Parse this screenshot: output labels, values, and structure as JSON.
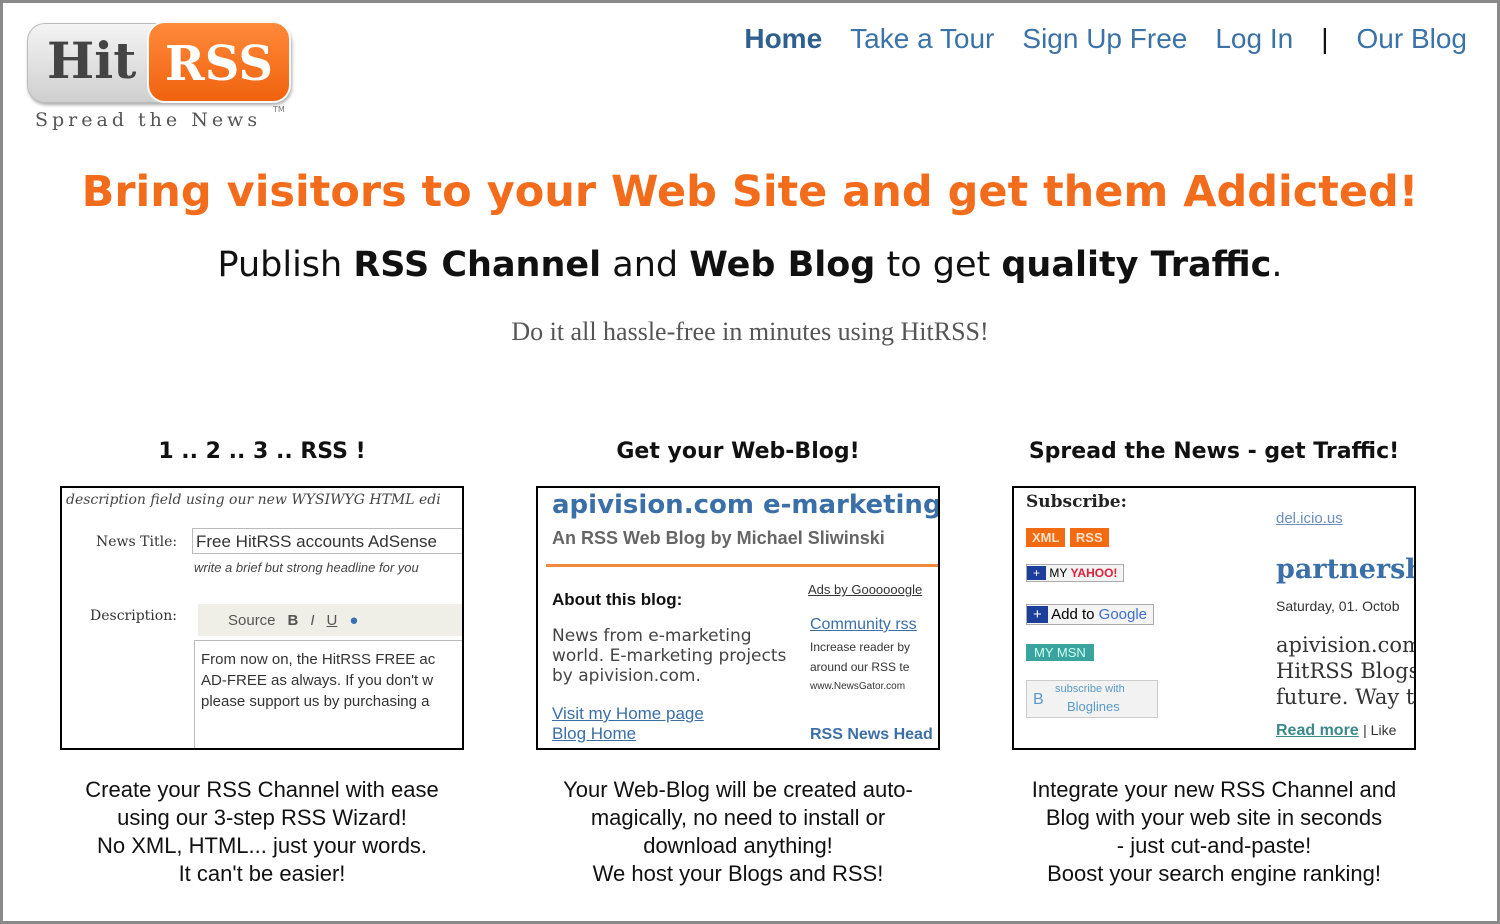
{
  "logo": {
    "hit": "Hit",
    "rss": "RSS",
    "tagline": "Spread the News",
    "tm": "TM"
  },
  "nav": {
    "items": [
      "Home",
      "Take a Tour",
      "Sign Up Free",
      "Log In",
      "|",
      "Our Blog"
    ]
  },
  "hero": {
    "headline": "Bring visitors to your Web Site and get them Addicted!",
    "sub": {
      "p1": "Publish ",
      "b1": "RSS Channel",
      "p2": " and ",
      "b2": "Web Blog",
      "p3": " to get ",
      "b3": "quality Traffic",
      "p4": "."
    },
    "tagline": "Do it all hassle-free in minutes using HitRSS!"
  },
  "columns": [
    {
      "title": "1 .. 2 .. 3 .. RSS !",
      "lines": [
        "Create your RSS Channel with ease",
        "using our 3-step RSS Wizard!",
        "No XML, HTML... just your words.",
        "It can't be easier!"
      ],
      "shot": {
        "top": "description field using our new WYSIWYG HTML edi",
        "news_title_label": "News Title:",
        "news_title_value": "Free HitRSS accounts AdSense",
        "hint": "write a brief but strong headline for you",
        "description_label": "Description:",
        "source": "Source",
        "bold": "B",
        "italic": "I",
        "underline": "U",
        "body": [
          "From now on, the HitRSS FREE ac",
          "AD-FREE as always. If you don't w",
          "please support us by purchasing a"
        ]
      }
    },
    {
      "title": "Get your Web-Blog!",
      "lines": [
        "Your Web-Blog will be created auto-",
        "magically, no need to install or",
        "download anything!",
        "We host your Blogs and RSS!"
      ],
      "shot": {
        "blog_title": "apivision.com e-marketing",
        "blog_sub": "An RSS Web Blog by Michael Sliwinski",
        "about": "About this blog:",
        "about_text": [
          "News from e-marketing",
          "world. E-marketing projects",
          "by apivision.com."
        ],
        "visit": "Visit my Home page",
        "blog_home": "Blog Home",
        "ads": "Ads by Goooooogle",
        "ad_title": "Community rss",
        "ad_lines": [
          "Increase reader by",
          "around our RSS te",
          "www.NewsGator.com"
        ],
        "rss_news": "RSS News Head"
      }
    },
    {
      "title": "Spread the News - get Traffic!",
      "lines": [
        "Integrate your new RSS Channel and",
        "Blog with your web site in seconds",
        "- just cut-and-paste!",
        "Boost your search engine ranking!"
      ],
      "shot": {
        "subscribe": "Subscribe:",
        "xml": "XML",
        "rss": "RSS",
        "yahoo_my": "MY",
        "yahoo": "YAHOO!",
        "google_add": "Add to",
        "google": "Google",
        "msn": "MY MSN",
        "bloglines_top": "subscribe with",
        "bloglines": "Bloglines",
        "delicious": "del.icio.us",
        "post_title": "partnersh",
        "date": "Saturday, 01. Octob",
        "post_lines": [
          "apivision.com",
          "HitRSS Blogs.",
          "future. Way to"
        ],
        "read_more": "Read more",
        "like": "| Like"
      }
    }
  ],
  "colors": {
    "accent": "#f36c1c",
    "link": "#3b73a8"
  }
}
